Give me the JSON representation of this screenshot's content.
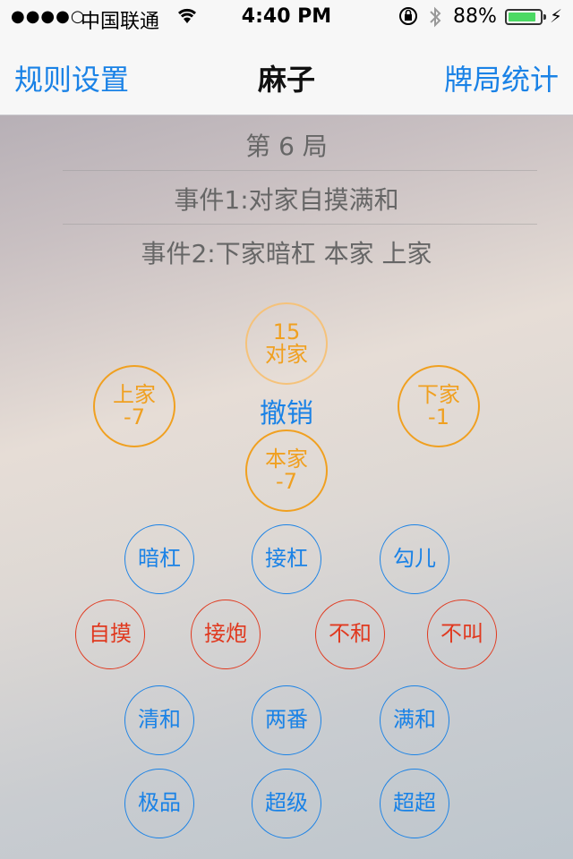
{
  "status": {
    "signal": "●●●●○",
    "carrier": "中国联通",
    "time": "4:40 PM",
    "battery_pct": "88%",
    "battery_level": 0.88
  },
  "nav": {
    "left": "规则设置",
    "title": "麻子",
    "right": "牌局统计"
  },
  "round_title": "第 6 局",
  "events": [
    "事件1:对家自摸满和",
    "事件2:下家暗杠 本家 上家"
  ],
  "players": {
    "opposite": {
      "label": "对家",
      "score": "15"
    },
    "left": {
      "label": "上家",
      "score": "-7"
    },
    "right": {
      "label": "下家",
      "score": "-1"
    },
    "self": {
      "label": "本家",
      "score": "-7"
    }
  },
  "undo_label": "撤销",
  "action_rows": {
    "row1": [
      "暗杠",
      "接杠",
      "勾儿"
    ],
    "row2": [
      "自摸",
      "接炮",
      "不和",
      "不叫"
    ],
    "row3": [
      "清和",
      "两番",
      "满和"
    ],
    "row4": [
      "极品",
      "超级",
      "超超"
    ]
  },
  "colors": {
    "accent": "#1a82e6",
    "player": "#f0a020",
    "danger": "#e0391f"
  }
}
